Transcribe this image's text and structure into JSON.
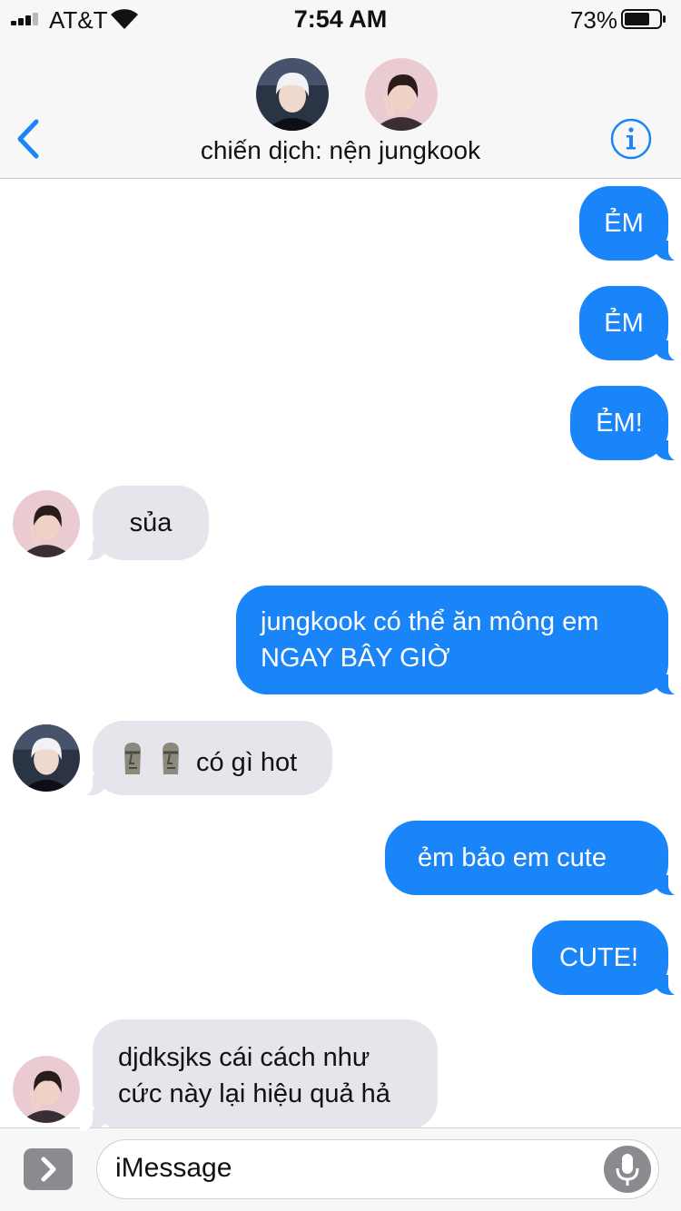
{
  "status_bar": {
    "carrier": "AT&T",
    "time": "7:54 AM",
    "battery_percent": "73%",
    "battery_level": 0.73,
    "signal_bars": 3
  },
  "header": {
    "title": "chiến dịch: nện jungkook",
    "back_icon": "chevron-left-icon",
    "info_icon": "info-icon"
  },
  "colors": {
    "outgoing_bubble": "#1a85f9",
    "incoming_bubble": "#e6e5eb",
    "accent": "#1a85f9"
  },
  "messages": [
    {
      "direction": "outgoing",
      "text": "ẺM"
    },
    {
      "direction": "outgoing",
      "text": "ẺM"
    },
    {
      "direction": "outgoing",
      "text": "ẺM!"
    },
    {
      "direction": "incoming",
      "sender_avatar": "pink-hoodie-avatar",
      "text": "sủa"
    },
    {
      "direction": "outgoing",
      "text": "jungkook có thể ăn mông em NGAY BÂY GIỜ"
    },
    {
      "direction": "incoming",
      "sender_avatar": "white-hair-avatar",
      "emoji": "moai-emoji",
      "text": "có gì hot"
    },
    {
      "direction": "outgoing",
      "text": "ẻm bảo em cute"
    },
    {
      "direction": "outgoing",
      "text": "CUTE!"
    },
    {
      "direction": "incoming",
      "sender_avatar": "pink-hoodie-avatar",
      "text": "djdksjks cái cách như cức này lại hiệu quả hả"
    }
  ],
  "composer": {
    "placeholder": "iMessage",
    "apps_icon": "chevron-right-icon",
    "mic_icon": "microphone-icon"
  }
}
